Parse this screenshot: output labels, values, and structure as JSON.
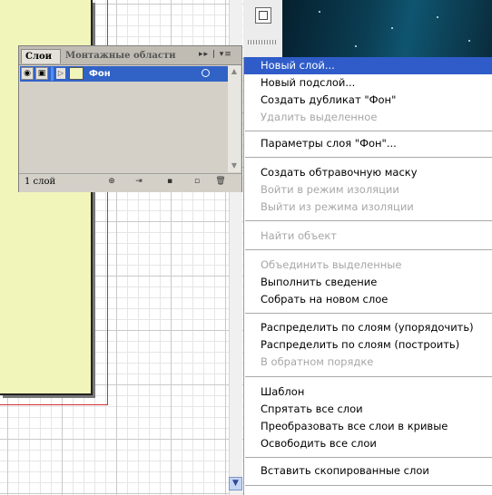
{
  "layers_panel": {
    "tabs": [
      "Слои",
      "Монтажные области"
    ],
    "menu_buttons": "▸▸ | ▾≡",
    "layers": [
      {
        "name": "Фон"
      }
    ],
    "layer_count": "1 слой"
  },
  "context_menu": {
    "groups": [
      [
        {
          "label": "Новый слой...",
          "enabled": true,
          "highlighted": true
        },
        {
          "label": "Новый подслой...",
          "enabled": true
        },
        {
          "label": "Создать дубликат \"Фон\"",
          "enabled": true
        },
        {
          "label": "Удалить выделенное",
          "enabled": false
        }
      ],
      [
        {
          "label": "Параметры слоя \"Фон\"...",
          "enabled": true
        }
      ],
      [
        {
          "label": "Создать обтравочную маску",
          "enabled": true
        },
        {
          "label": "Войти в режим изоляции",
          "enabled": false
        },
        {
          "label": "Выйти из режима изоляции",
          "enabled": false
        }
      ],
      [
        {
          "label": "Найти объект",
          "enabled": false
        }
      ],
      [
        {
          "label": "Объединить выделенные",
          "enabled": false
        },
        {
          "label": "Выполнить сведение",
          "enabled": true
        },
        {
          "label": "Собрать на новом слое",
          "enabled": true
        }
      ],
      [
        {
          "label": "Распределить по слоям (упорядочить)",
          "enabled": true
        },
        {
          "label": "Распределить по слоям (построить)",
          "enabled": true
        },
        {
          "label": "В обратном порядке",
          "enabled": false
        }
      ],
      [
        {
          "label": "Шаблон",
          "enabled": true
        },
        {
          "label": "Спрятать все слои",
          "enabled": true
        },
        {
          "label": "Преобразовать все слои в кривые",
          "enabled": true
        },
        {
          "label": "Освободить все слои",
          "enabled": true
        }
      ],
      [
        {
          "label": "Вставить скопированные слои",
          "enabled": true
        }
      ]
    ]
  },
  "colors": {
    "highlight": "#2f5cc9",
    "selected_layer": "#3162c6",
    "artboard_fill": "#f1f5b9",
    "guide_red": "#d03030",
    "disabled_text": "#a7a7a7"
  }
}
